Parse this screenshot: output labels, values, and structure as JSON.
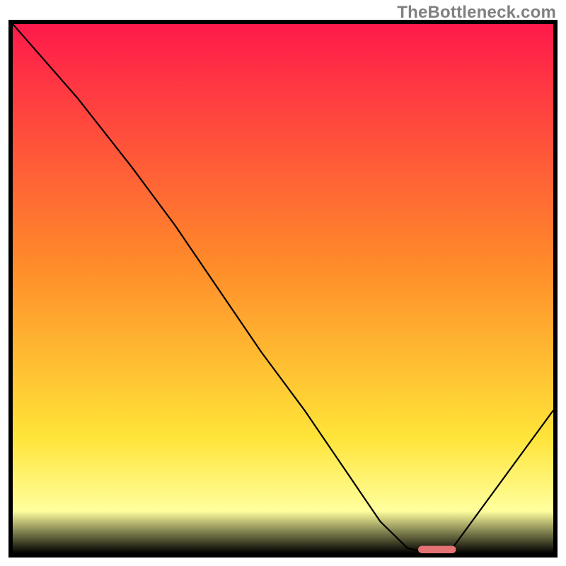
{
  "watermark": "TheBottleneck.com",
  "chart_data": {
    "type": "line",
    "title": "",
    "xlabel": "",
    "ylabel": "",
    "x_range": [
      0,
      100
    ],
    "y_range": [
      0,
      100
    ],
    "line": {
      "x": [
        0,
        12,
        22,
        30,
        38,
        46,
        54,
        62,
        68,
        73,
        77,
        81,
        100
      ],
      "y": [
        100,
        86,
        73,
        62,
        50,
        38,
        27,
        15,
        6,
        1,
        0,
        0.5,
        27
      ]
    },
    "marker": {
      "x_start": 75,
      "x_end": 82,
      "y": 0,
      "color": "#e57373"
    },
    "background_gradient": {
      "top": "#ff1a4b",
      "mid1": "#ff8a2a",
      "mid2": "#ffe438",
      "low": "#ffff9e",
      "bottom": "#32e07a"
    }
  }
}
